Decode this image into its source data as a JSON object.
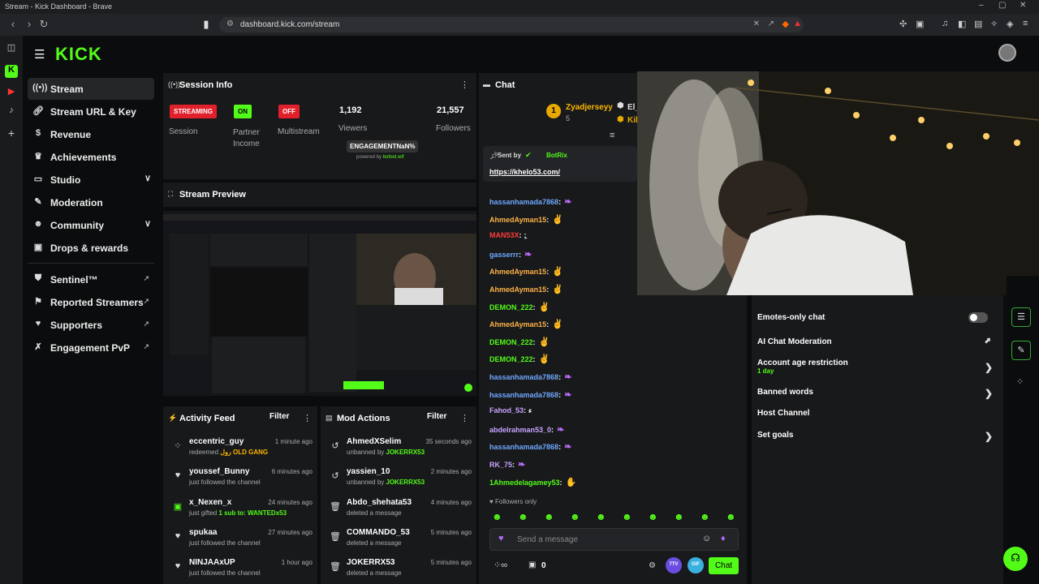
{
  "window": {
    "title": "Stream - Kick Dashboard - Brave",
    "url": "dashboard.kick.com/stream"
  },
  "brand": {
    "logo": "KICK",
    "accent": "#53fc18"
  },
  "sidebar": {
    "items": [
      {
        "label": "Stream",
        "icon": "broadcast-icon"
      },
      {
        "label": "Stream URL & Key",
        "icon": "link-icon"
      },
      {
        "label": "Revenue",
        "icon": "dollar-icon"
      },
      {
        "label": "Achievements",
        "icon": "trophy-icon"
      },
      {
        "label": "Studio",
        "icon": "studio-icon"
      },
      {
        "label": "Moderation",
        "icon": "wrench-icon"
      },
      {
        "label": "Community",
        "icon": "people-icon"
      },
      {
        "label": "Drops & rewards",
        "icon": "gift-icon"
      },
      {
        "label": "Sentinel™",
        "icon": "shield-icon"
      },
      {
        "label": "Reported Streamers",
        "icon": "flag-icon"
      },
      {
        "label": "Supporters",
        "icon": "heart-icon"
      },
      {
        "label": "Engagement PvP",
        "icon": "swords-icon"
      }
    ]
  },
  "session": {
    "title": "Session Info",
    "streaming_badge": "STREAMING",
    "session_label": "Session",
    "partner_badge": "ON",
    "partner_label": "Partner Income",
    "multistream_badge": "OFF",
    "multistream_label": "Multistream",
    "viewers": "1,192",
    "viewers_label": "Viewers",
    "followers": "21,557",
    "followers_label": "Followers",
    "engagement": "ENGAGEMENTNaN%",
    "powered_prefix": "powered by ",
    "powered_link": "botted.wtf"
  },
  "preview": {
    "title": "Stream Preview"
  },
  "activity": {
    "title": "Activity Feed",
    "filter": "Filter",
    "items": [
      {
        "name": "eccentric_guy",
        "time": "1 minute ago",
        "prefix": "redeemed ",
        "highlight": "رول OLD GANG",
        "suffix": "",
        "icon": "points-icon"
      },
      {
        "name": "youssef_Bunny",
        "time": "6 minutes ago",
        "prefix": "just followed the channel",
        "highlight": "",
        "suffix": "",
        "icon": "heart-icon"
      },
      {
        "name": "x_Nexen_x",
        "time": "24 minutes ago",
        "prefix": "just gifted ",
        "highlight": "1",
        "suffix": " sub to: WANTEDx53",
        "icon": "gift-icon"
      },
      {
        "name": "spukaa",
        "time": "27 minutes ago",
        "prefix": "just followed the channel",
        "highlight": "",
        "suffix": "",
        "icon": "heart-icon"
      },
      {
        "name": "NINJAAxUP",
        "time": "1 hour ago",
        "prefix": "just followed the channel",
        "highlight": "",
        "suffix": "",
        "icon": "heart-icon"
      }
    ]
  },
  "modactions": {
    "title": "Mod Actions",
    "filter": "Filter",
    "items": [
      {
        "name": "AhmedXSelim",
        "time": "35 seconds ago",
        "prefix": "unbanned by ",
        "highlight": "JOKERRX53",
        "icon": "undo-icon"
      },
      {
        "name": "yassien_10",
        "time": "2 minutes ago",
        "prefix": "unbanned by ",
        "highlight": "JOKERRX53",
        "icon": "undo-icon"
      },
      {
        "name": "Abdo_shehata53",
        "time": "4 minutes ago",
        "prefix": "deleted a message",
        "highlight": "",
        "icon": "trash-icon"
      },
      {
        "name": "COMMANDO_53",
        "time": "5 minutes ago",
        "prefix": "deleted a message",
        "highlight": "",
        "icon": "trash-icon"
      },
      {
        "name": "JOKERRX53",
        "time": "5 minutes ago",
        "prefix": "deleted a message",
        "highlight": "",
        "icon": "trash-icon"
      }
    ]
  },
  "chat": {
    "title": "Chat",
    "top_gifter": "Zyadjerseyy",
    "top_gifter_count": "5",
    "gifter2": "El_",
    "gifter2_b": "Kil",
    "pinned_sent_by": "Sent by",
    "pinned_user": "BotRix",
    "pinned_link": "https://khelo53.com/",
    "messages": [
      {
        "user": "hassanhamada7868",
        "color": "#6fa8ff",
        "text": ""
      },
      {
        "user": "AhmedAyman15",
        "color": "#ffb347",
        "text": ""
      },
      {
        "user": "MAN53X",
        "color": "#ff3b3b",
        "text": "ِ:"
      },
      {
        "user": "gasserrr",
        "color": "#6fa8ff",
        "text": ""
      },
      {
        "user": "AhmedAyman15",
        "color": "#ffb347",
        "text": ""
      },
      {
        "user": "AhmedAyman15",
        "color": "#ffb347",
        "text": ""
      },
      {
        "user": "DEMON_222",
        "color": "#53fc18",
        "text": ""
      },
      {
        "user": "AhmedAyman15",
        "color": "#ffb347",
        "text": ""
      },
      {
        "user": "DEMON_222",
        "color": "#53fc18",
        "text": ""
      },
      {
        "user": "DEMON_222",
        "color": "#53fc18",
        "text": ""
      },
      {
        "user": "hassanhamada7868",
        "color": "#6fa8ff",
        "text": ""
      },
      {
        "user": "hassanhamada7868",
        "color": "#6fa8ff",
        "text": ""
      },
      {
        "user": "Fahod_53",
        "color": "#c9a3ff",
        "text": "ء"
      },
      {
        "user": "abdelrahman53_0",
        "color": "#c9a3ff",
        "text": ""
      },
      {
        "user": "hassanhamada7868",
        "color": "#6fa8ff",
        "text": ""
      },
      {
        "user": "RK_75",
        "color": "#c9a3ff",
        "text": ""
      },
      {
        "user": "1Ahmedelagamey53",
        "color": "#53fc18",
        "text": ""
      }
    ],
    "followers_only": "Followers only",
    "placeholder": "Send a message",
    "points": "0",
    "chat_button": "Chat",
    "seventv": "7TV",
    "gif": "GIF"
  },
  "settings": {
    "rows": [
      {
        "label": "Emotes-only chat",
        "sub": "",
        "type": "toggle"
      },
      {
        "label": "AI Chat Moderation",
        "sub": "",
        "type": "chart"
      },
      {
        "label": "Account age restriction",
        "sub": "1 day",
        "type": "chevron"
      },
      {
        "label": "Banned words",
        "sub": "",
        "type": "chevron"
      },
      {
        "label": "Host Channel",
        "sub": "",
        "type": "none"
      },
      {
        "label": "Set goals",
        "sub": "",
        "type": "chevron"
      }
    ]
  }
}
